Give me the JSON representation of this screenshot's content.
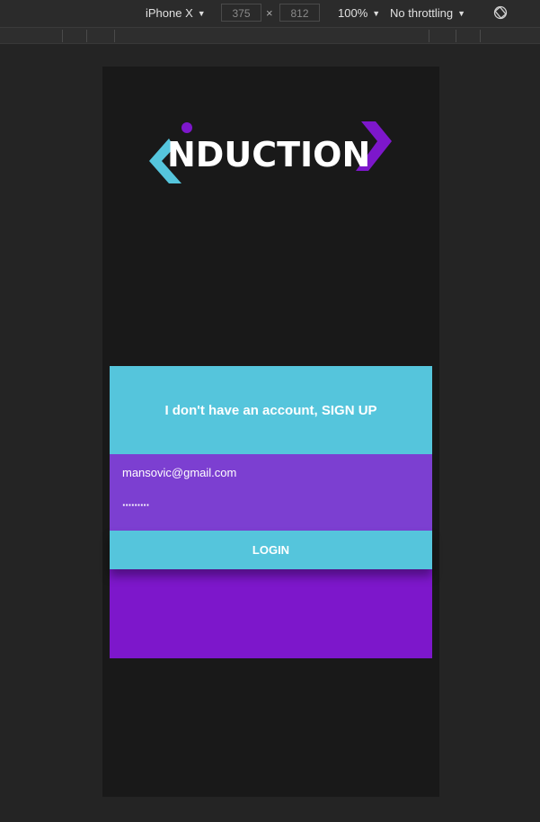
{
  "toolbar": {
    "device": "iPhone X",
    "width": "375",
    "height": "812",
    "times": "×",
    "zoom": "100%",
    "throttling": "No throttling"
  },
  "app": {
    "logo_text": "NDUCTION",
    "colors": {
      "accent_cyan": "#55c5dc",
      "accent_purple": "#7d17cb",
      "form_purple": "#7c3fd1",
      "background": "#191919"
    }
  },
  "card": {
    "signup_label": "I don't have an account, SIGN UP",
    "email_value": "mansovic@gmail.com",
    "password_value": "·········",
    "login_label": "LOGIN"
  }
}
